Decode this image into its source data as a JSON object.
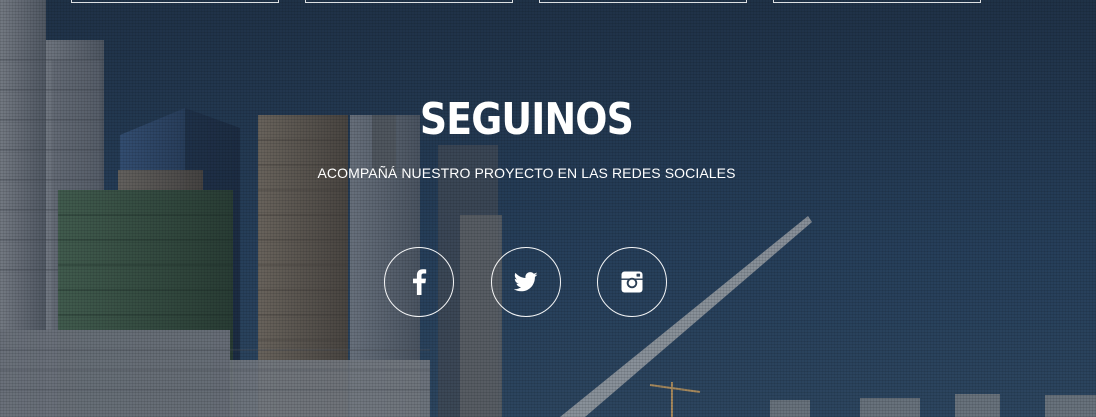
{
  "section": {
    "title": "SEGUINOS",
    "subtitle": "ACOMPAÑÁ NUESTRO PROYECTO EN LAS REDES SOCIALES"
  },
  "top_boxes": [
    {
      "name": "top-box-1"
    },
    {
      "name": "top-box-2"
    },
    {
      "name": "top-box-3"
    },
    {
      "name": "top-box-4"
    }
  ],
  "social": [
    {
      "network": "facebook",
      "icon": "facebook-icon"
    },
    {
      "network": "twitter",
      "icon": "twitter-icon"
    },
    {
      "network": "instagram",
      "icon": "instagram-icon"
    }
  ],
  "colors": {
    "text": "#ffffff",
    "sky": "#2b4a6b",
    "overlay": "#14243a"
  }
}
